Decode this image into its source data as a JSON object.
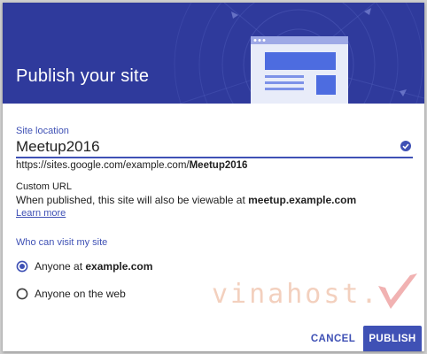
{
  "dialog": {
    "title": "Publish your site",
    "header_color": "#2f3a9c",
    "accent_color": "#3f51b5"
  },
  "site_location": {
    "label": "Site location",
    "value": "Meetup2016",
    "url_prefix": "https://sites.google.com/example.com/",
    "url_name": "Meetup2016",
    "status_icon": "check-circle-icon"
  },
  "custom_url": {
    "label": "Custom URL",
    "text_prefix": "When published, this site will also be viewable at ",
    "domain": "meetup.example.com",
    "learn_more": "Learn more"
  },
  "visibility": {
    "label": "Who can visit my site",
    "options": [
      {
        "prefix": "Anyone at ",
        "domain": "example.com",
        "selected": true
      },
      {
        "prefix": "Anyone on the web",
        "domain": "",
        "selected": false
      }
    ]
  },
  "watermark": {
    "text": "vinahost."
  },
  "buttons": {
    "cancel": "CANCEL",
    "publish": "PUBLISH"
  }
}
